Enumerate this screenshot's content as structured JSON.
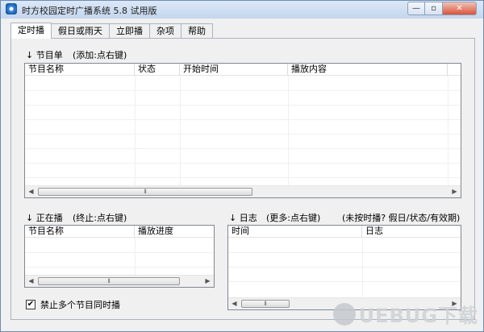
{
  "window": {
    "title": "时方校园定时广播系统 5.8 试用版",
    "minimize_glyph": "—",
    "restore_glyph": "▫",
    "close_glyph": "✕"
  },
  "tabs": [
    "定时播",
    "假日或雨天",
    "立即播",
    "杂项",
    "帮助"
  ],
  "schedule": {
    "arrow": "↓",
    "title": "节目单",
    "hint": "(添加:点右键)",
    "columns": [
      "节目名称",
      "状态",
      "开始时间",
      "播放内容"
    ]
  },
  "playing": {
    "arrow": "↓",
    "title": "正在播",
    "hint": "(终止:点右键)",
    "columns": [
      "节目名称",
      "播放进度"
    ]
  },
  "log": {
    "arrow": "↓",
    "title": "日志",
    "hint": "(更多:点右键)",
    "extra": "(未按时播? 假日/状态/有效期)",
    "columns": [
      "时间",
      "日志"
    ]
  },
  "scroll": {
    "left": "◀",
    "right": "▶",
    "grip": "⦀"
  },
  "options": {
    "multi_program_label": "禁止多个节目同时播",
    "multi_program_checked": true,
    "check_glyph": "✔"
  },
  "watermark": {
    "text": "UEBUG下载"
  }
}
